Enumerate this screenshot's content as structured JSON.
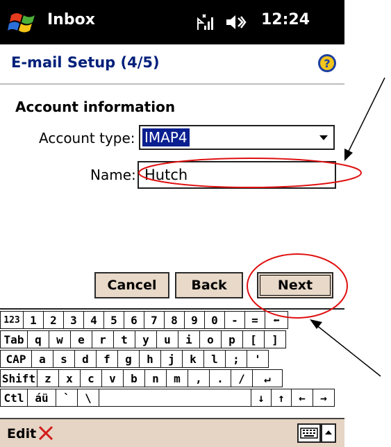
{
  "titlebar": {
    "app_title": "Inbox",
    "time": "12:24",
    "icons": [
      "windows-start-icon",
      "signal-icon",
      "volume-icon"
    ]
  },
  "header": {
    "title": "E-mail Setup (4/5)",
    "help_icon": "help-icon"
  },
  "form": {
    "section_title": "Account information",
    "account_type_label": "Account type:",
    "account_type_value": "IMAP4",
    "name_label": "Name:",
    "name_value": "Hutch"
  },
  "buttons": {
    "cancel": "Cancel",
    "back": "Back",
    "next": "Next"
  },
  "keyboard": {
    "rows": [
      [
        "123",
        "1",
        "2",
        "3",
        "4",
        "5",
        "6",
        "7",
        "8",
        "9",
        "0",
        "-",
        "=",
        "⬅"
      ],
      [
        "Tab",
        "q",
        "w",
        "e",
        "r",
        "t",
        "y",
        "u",
        "i",
        "o",
        "p",
        "[",
        "]"
      ],
      [
        "CAP",
        "a",
        "s",
        "d",
        "f",
        "g",
        "h",
        "j",
        "k",
        "l",
        ";",
        "'"
      ],
      [
        "Shift",
        "z",
        "x",
        "c",
        "v",
        "b",
        "n",
        "m",
        ",",
        ".",
        "/",
        "↵"
      ],
      [
        "Ctl",
        "áü",
        "`",
        "\\",
        "",
        "↓",
        "↑",
        "←",
        "→"
      ]
    ]
  },
  "menubar": {
    "edit_label": "Edit"
  },
  "colors": {
    "titlebar_bg": "#000000",
    "header_text": "#00207a",
    "selection_bg": "#0a1f90",
    "button_bg": "#e8d9c8",
    "menubar_bg": "#e6d4c4",
    "annotation_red": "#e01010"
  }
}
